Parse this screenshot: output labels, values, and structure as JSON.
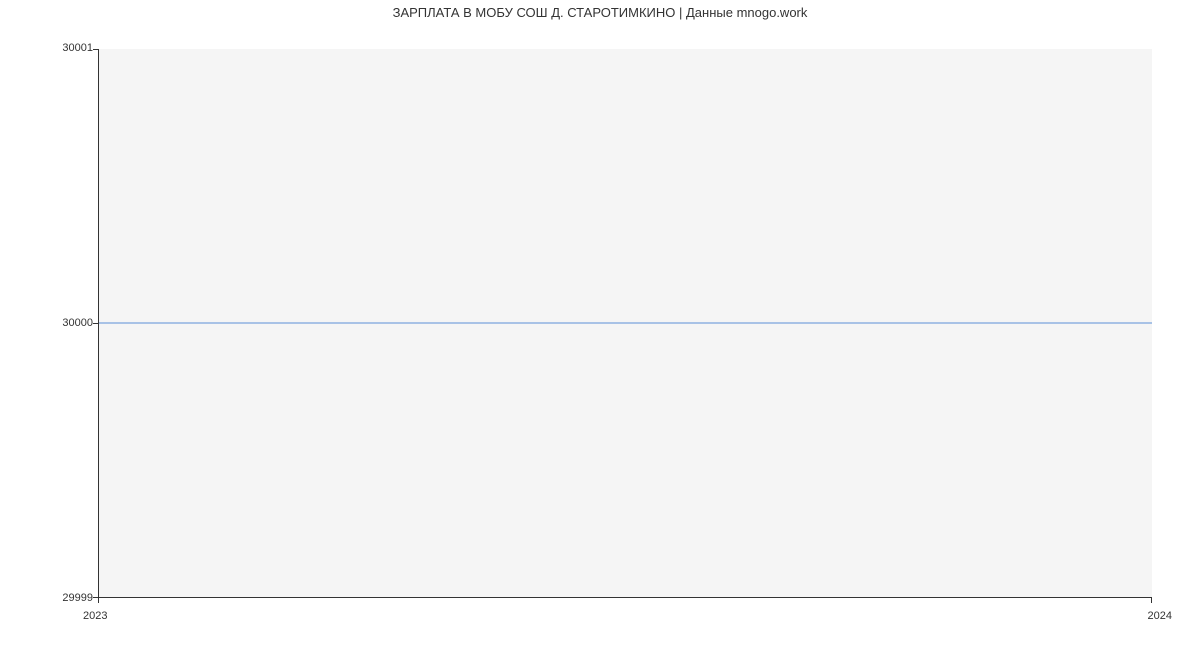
{
  "chart_data": {
    "type": "line",
    "title": "ЗАРПЛАТА В МОБУ СОШ Д. СТАРОТИМКИНО | Данные mnogo.work",
    "x": [
      "2023",
      "2024"
    ],
    "values": [
      30000,
      30000
    ],
    "xlabel": "",
    "ylabel": "",
    "ylim": [
      29999,
      30001
    ],
    "y_ticks": [
      "29999",
      "30000",
      "30001"
    ],
    "x_ticks": [
      "2023",
      "2024"
    ],
    "line_color": "#5b8fd6",
    "background": "#f5f5f5"
  }
}
